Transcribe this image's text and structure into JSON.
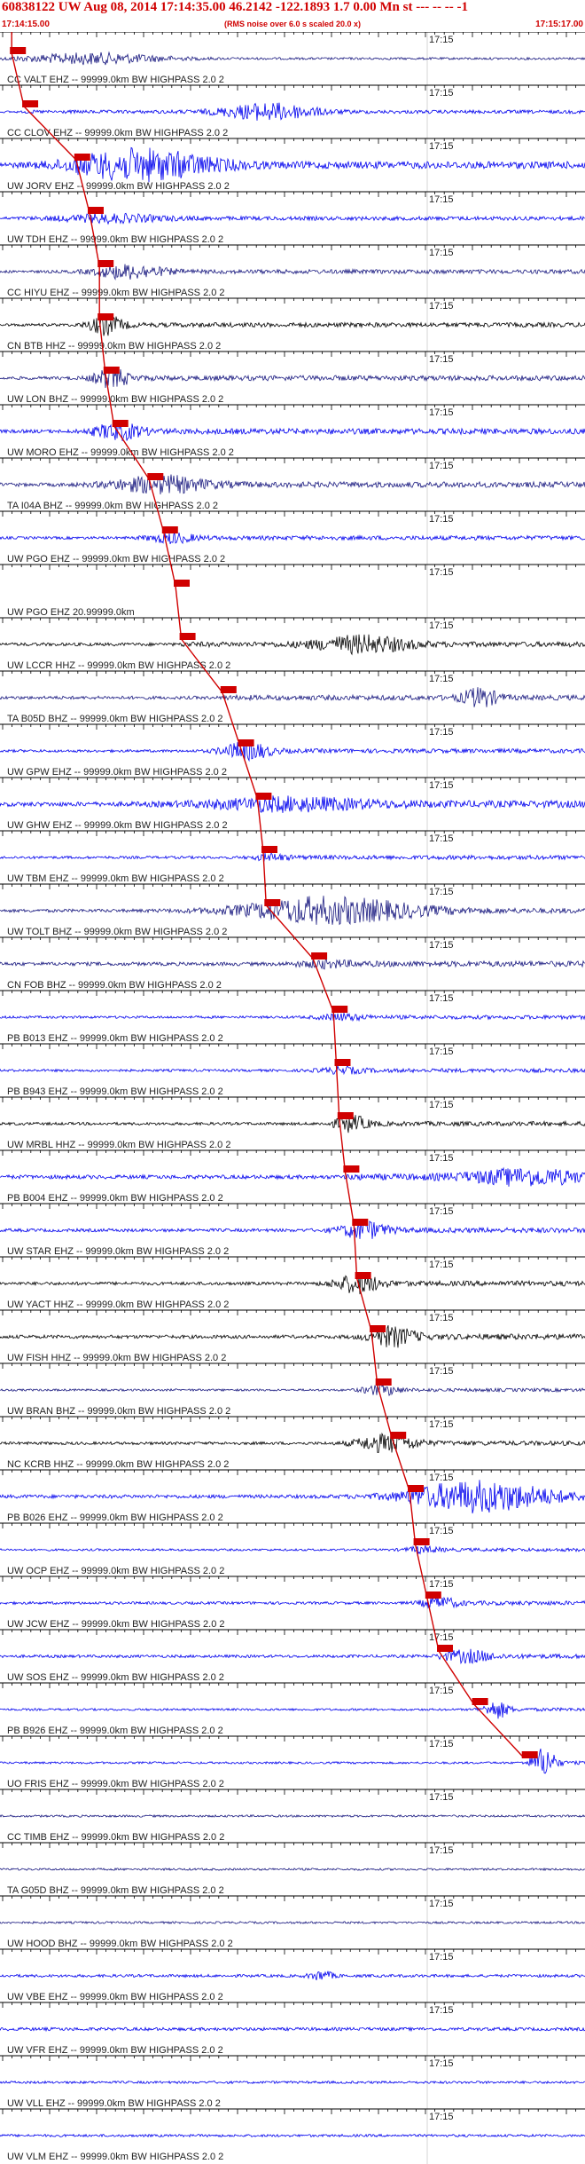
{
  "header": {
    "title": "60838122 UW Aug 08, 2014 17:14:35.00   46.2142 -122.1893  1.7 0.00 Mn st --- -- --   -1",
    "subtitle": "(RMS noise over 6.0 s scaled 20.0 x)",
    "start_time": "17:14:15.00",
    "end_time": "17:15:17.00"
  },
  "minute_mark": "17:15",
  "colors": {
    "header_red": "#d00000",
    "pick_red": "#d00000",
    "trace_blue": "#0000ee",
    "trace_navy": "#1a1a80",
    "trace_black": "#000000"
  },
  "traces": [
    {
      "label": "CC VALT EHZ -- 99999.0km BW  HIGHPASS  2.0  2",
      "color": "#1a1a80",
      "pick": 0.02,
      "amp": 0.8,
      "burst": [
        0.16,
        0.12
      ],
      "burst_amp": 6
    },
    {
      "label": "CC CLOV EHZ -- 99999.0km BW  HIGHPASS  2.0  2",
      "color": "#0000ee",
      "pick": 0.041,
      "amp": 1.2,
      "burst": [
        0.46,
        0.08
      ],
      "burst_amp": 9
    },
    {
      "label": "UW JORV EHZ -- 99999.0km BW  HIGHPASS  2.0  2",
      "color": "#0000ee",
      "pick": 0.13,
      "amp": 2.5,
      "burst": [
        0.24,
        0.12
      ],
      "burst_amp": 16
    },
    {
      "label": "UW TDH EHZ -- 99999.0km BW  HIGHPASS  2.0  2",
      "color": "#0000ee",
      "pick": 0.153,
      "amp": 1.4,
      "burst": [
        0.18,
        0.1
      ],
      "burst_amp": 4
    },
    {
      "label": "CC HIYU EHZ -- 99999.0km BW  HIGHPASS  2.0  2",
      "color": "#1a1a80",
      "pick": 0.17,
      "amp": 1.5,
      "burst": [
        0.22,
        0.06
      ],
      "burst_amp": 7
    },
    {
      "label": "CN BTB HHZ -- 99999.0km BW  HIGHPASS  2.0  2",
      "color": "#000000",
      "pick": 0.17,
      "amp": 1.6,
      "burst": [
        0.18,
        0.03
      ],
      "burst_amp": 10
    },
    {
      "label": "UW LON BHZ -- 99999.0km BW  HIGHPASS  2.0  2",
      "color": "#1a1a80",
      "pick": 0.18,
      "amp": 1.8,
      "burst": [
        0.19,
        0.03
      ],
      "burst_amp": 10
    },
    {
      "label": "UW MORO EHZ -- 99999.0km BW  HIGHPASS  2.0  2",
      "color": "#0000ee",
      "pick": 0.195,
      "amp": 2.0,
      "burst": [
        0.2,
        0.04
      ],
      "burst_amp": 9
    },
    {
      "label": "TA I04A BHZ -- 99999.0km BW  HIGHPASS  2.0  2",
      "color": "#1a1a80",
      "pick": 0.255,
      "amp": 2.0,
      "burst": [
        0.27,
        0.08
      ],
      "burst_amp": 9
    },
    {
      "label": "UW PGO EHZ -- 99999.0km BW  HIGHPASS  2.0  2",
      "color": "#0000ee",
      "pick": 0.28,
      "amp": 1.5,
      "burst": [
        0.29,
        0.04
      ],
      "burst_amp": 5
    },
    {
      "label": "UW PGO EHZ 20.99999.0km",
      "color": "#1a1a80",
      "pick": 0.3,
      "amp": 0,
      "burst": [
        0,
        0
      ],
      "burst_amp": 0
    },
    {
      "label": "UW LCCR HHZ -- 99999.0km BW  HIGHPASS  2.0  2",
      "color": "#000000",
      "pick": 0.31,
      "amp": 1.8,
      "burst": [
        0.62,
        0.08
      ],
      "burst_amp": 9
    },
    {
      "label": "TA B05D BHZ -- 99999.0km BW  HIGHPASS  2.0  2",
      "color": "#1a1a80",
      "pick": 0.38,
      "amp": 1.8,
      "burst": [
        0.82,
        0.03
      ],
      "burst_amp": 10
    },
    {
      "label": "UW GPW EHZ -- 99999.0km BW  HIGHPASS  2.0  2",
      "color": "#0000ee",
      "pick": 0.41,
      "amp": 1.5,
      "burst": [
        0.42,
        0.04
      ],
      "burst_amp": 10
    },
    {
      "label": "UW GHW EHZ -- 99999.0km BW  HIGHPASS  2.0  2",
      "color": "#0000ee",
      "pick": 0.44,
      "amp": 2.5,
      "burst": [
        0.48,
        0.15
      ],
      "burst_amp": 6
    },
    {
      "label": "UW TBM EHZ -- 99999.0km BW  HIGHPASS  2.0  2",
      "color": "#0000ee",
      "pick": 0.45,
      "amp": 1.5,
      "burst": [
        0.46,
        0.03
      ],
      "burst_amp": 3
    },
    {
      "label": "UW TOLT BHZ -- 99999.0km BW  HIGHPASS  2.0  2",
      "color": "#1a1a80",
      "pick": 0.455,
      "amp": 1.8,
      "burst": [
        0.56,
        0.15
      ],
      "burst_amp": 14
    },
    {
      "label": "CN FOB BHZ -- 99999.0km BW  HIGHPASS  2.0  2",
      "color": "#1a1a80",
      "pick": 0.535,
      "amp": 2.0,
      "burst": [
        0.55,
        0.05
      ],
      "burst_amp": 3
    },
    {
      "label": "PB B013 EHZ -- 99999.0km BW  HIGHPASS  2.0  2",
      "color": "#0000ee",
      "pick": 0.57,
      "amp": 1.4,
      "burst": [
        0.58,
        0.04
      ],
      "burst_amp": 3
    },
    {
      "label": "PB B943 EHZ -- 99999.0km BW  HIGHPASS  2.0  2",
      "color": "#0000ee",
      "pick": 0.575,
      "amp": 1.4,
      "burst": [
        0.58,
        0.04
      ],
      "burst_amp": 3
    },
    {
      "label": "UW MRBL HHZ -- 99999.0km BW  HIGHPASS  2.0  2",
      "color": "#000000",
      "pick": 0.58,
      "amp": 1.6,
      "burst": [
        0.6,
        0.03
      ],
      "burst_amp": 8
    },
    {
      "label": "PB B004 EHZ -- 99999.0km BW  HIGHPASS  2.0  2",
      "color": "#0000ee",
      "pick": 0.59,
      "amp": 2.2,
      "burst": [
        0.9,
        0.1
      ],
      "burst_amp": 8
    },
    {
      "label": "UW STAR EHZ -- 99999.0km BW  HIGHPASS  2.0  2",
      "color": "#0000ee",
      "pick": 0.605,
      "amp": 1.8,
      "burst": [
        0.62,
        0.04
      ],
      "burst_amp": 9
    },
    {
      "label": "UW YACT HHZ -- 99999.0km BW  HIGHPASS  2.0  2",
      "color": "#000000",
      "pick": 0.61,
      "amp": 1.8,
      "burst": [
        0.61,
        0.04
      ],
      "burst_amp": 10
    },
    {
      "label": "UW FISH HHZ -- 99999.0km BW  HIGHPASS  2.0  2",
      "color": "#000000",
      "pick": 0.635,
      "amp": 2.0,
      "burst": [
        0.67,
        0.04
      ],
      "burst_amp": 10
    },
    {
      "label": "UW BRAN BHZ -- 99999.0km BW  HIGHPASS  2.0  2",
      "color": "#1a1a80",
      "pick": 0.645,
      "amp": 1.2,
      "burst": [
        0.65,
        0.03
      ],
      "burst_amp": 6
    },
    {
      "label": "NC KCRB HHZ -- 99999.0km BW  HIGHPASS  2.0  2",
      "color": "#000000",
      "pick": 0.67,
      "amp": 1.6,
      "burst": [
        0.66,
        0.05
      ],
      "burst_amp": 10
    },
    {
      "label": "PB B026 EHZ -- 99999.0km BW  HIGHPASS  2.0  2",
      "color": "#0000ee",
      "pick": 0.7,
      "amp": 2.0,
      "burst": [
        0.82,
        0.12
      ],
      "burst_amp": 16
    },
    {
      "label": "UW OCP EHZ -- 99999.0km BW  HIGHPASS  2.0  2",
      "color": "#0000ee",
      "pick": 0.71,
      "amp": 1.2,
      "burst": [
        0.72,
        0.03
      ],
      "burst_amp": 3
    },
    {
      "label": "UW JCW EHZ -- 99999.0km BW  HIGHPASS  2.0  2",
      "color": "#0000ee",
      "pick": 0.73,
      "amp": 1.5,
      "burst": [
        0.75,
        0.03
      ],
      "burst_amp": 6
    },
    {
      "label": "UW SOS EHZ -- 99999.0km BW  HIGHPASS  2.0  2",
      "color": "#0000ee",
      "pick": 0.75,
      "amp": 1.6,
      "burst": [
        0.8,
        0.04
      ],
      "burst_amp": 6
    },
    {
      "label": "PB B926 EHZ -- 99999.0km BW  HIGHPASS  2.0  2",
      "color": "#0000ee",
      "pick": 0.81,
      "amp": 1.2,
      "burst": [
        0.85,
        0.02
      ],
      "burst_amp": 9
    },
    {
      "label": "UO FRIS EHZ -- 99999.0km BW  HIGHPASS  2.0  2",
      "color": "#0000ee",
      "pick": 0.895,
      "amp": 1.2,
      "burst": [
        0.93,
        0.02
      ],
      "burst_amp": 16
    },
    {
      "label": "CC TIMB EHZ -- 99999.0km BW  HIGHPASS  2.0  2",
      "color": "#1a1a80",
      "pick": -1,
      "amp": 1.2,
      "burst": [
        0,
        0
      ],
      "burst_amp": 0
    },
    {
      "label": "TA G05D BHZ -- 99999.0km BW  HIGHPASS  2.0  2",
      "color": "#1a1a80",
      "pick": -1,
      "amp": 1.2,
      "burst": [
        0,
        0
      ],
      "burst_amp": 0
    },
    {
      "label": "UW HOOD BHZ -- 99999.0km BW  HIGHPASS  2.0  2",
      "color": "#1a1a80",
      "pick": -1,
      "amp": 1.2,
      "burst": [
        0,
        0
      ],
      "burst_amp": 0
    },
    {
      "label": "UW VBE EHZ -- 99999.0km BW  HIGHPASS  2.0  2",
      "color": "#0000ee",
      "pick": -1,
      "amp": 1.6,
      "burst": [
        0.55,
        0.02
      ],
      "burst_amp": 5
    },
    {
      "label": "UW VFR EHZ -- 99999.0km BW  HIGHPASS  2.0  2",
      "color": "#0000ee",
      "pick": -1,
      "amp": 1.8,
      "burst": [
        0,
        0
      ],
      "burst_amp": 0
    },
    {
      "label": "UW VLL EHZ -- 99999.0km BW  HIGHPASS  2.0  2",
      "color": "#0000ee",
      "pick": -1,
      "amp": 1.4,
      "burst": [
        0,
        0
      ],
      "burst_amp": 0
    },
    {
      "label": "UW VLM EHZ -- 99999.0km BW  HIGHPASS  2.0  2",
      "color": "#0000ee",
      "pick": -1,
      "amp": 1.4,
      "burst": [
        0,
        0
      ],
      "burst_amp": 0
    }
  ]
}
